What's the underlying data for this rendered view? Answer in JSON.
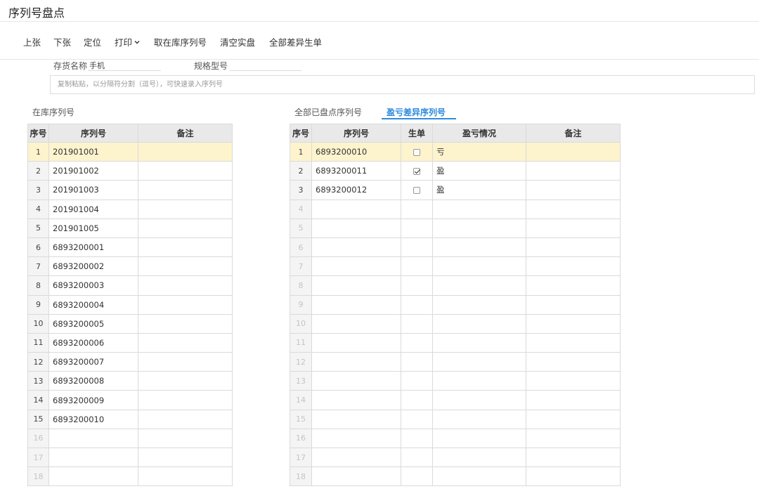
{
  "window": {
    "title": "序列号盘点"
  },
  "toolbar": {
    "prev": "上张",
    "next": "下张",
    "locate": "定位",
    "print": "打印",
    "fetch": "取在库序列号",
    "clear": "清空实盘",
    "all_diff": "全部差异生单"
  },
  "filter": {
    "stock_label": "存货名称",
    "stock_value": "手机",
    "spec_label": "规格型号",
    "spec_value": "",
    "paste_placeholder": "复制粘贴，以分隔符分割（逗号），可快速录入序列号"
  },
  "left": {
    "title": "在库序列号",
    "columns": [
      "序号",
      "序列号",
      "备注"
    ],
    "rows": [
      {
        "no": "1",
        "serial": "201901001",
        "note": ""
      },
      {
        "no": "2",
        "serial": "201901002",
        "note": ""
      },
      {
        "no": "3",
        "serial": "201901003",
        "note": ""
      },
      {
        "no": "4",
        "serial": "201901004",
        "note": ""
      },
      {
        "no": "5",
        "serial": "201901005",
        "note": ""
      },
      {
        "no": "6",
        "serial": "6893200001",
        "note": ""
      },
      {
        "no": "7",
        "serial": "6893200002",
        "note": ""
      },
      {
        "no": "8",
        "serial": "6893200003",
        "note": ""
      },
      {
        "no": "9",
        "serial": "6893200004",
        "note": ""
      },
      {
        "no": "10",
        "serial": "6893200005",
        "note": ""
      },
      {
        "no": "11",
        "serial": "6893200006",
        "note": ""
      },
      {
        "no": "12",
        "serial": "6893200007",
        "note": ""
      },
      {
        "no": "13",
        "serial": "6893200008",
        "note": ""
      },
      {
        "no": "14",
        "serial": "6893200009",
        "note": ""
      },
      {
        "no": "15",
        "serial": "6893200010",
        "note": ""
      },
      {
        "no": "16",
        "serial": "",
        "note": ""
      },
      {
        "no": "17",
        "serial": "",
        "note": ""
      },
      {
        "no": "18",
        "serial": "",
        "note": ""
      }
    ]
  },
  "tabs": [
    {
      "label": "全部已盘点序列号",
      "active": false
    },
    {
      "label": "盈亏差异序列号",
      "active": true
    }
  ],
  "right": {
    "columns": [
      "序号",
      "序列号",
      "生单",
      "盈亏情况",
      "备注"
    ],
    "rows": [
      {
        "no": "1",
        "serial": "6893200010",
        "checked": false,
        "status": "亏",
        "note": ""
      },
      {
        "no": "2",
        "serial": "6893200011",
        "checked": true,
        "status": "盈",
        "note": ""
      },
      {
        "no": "3",
        "serial": "6893200012",
        "checked": false,
        "status": "盈",
        "note": ""
      },
      {
        "no": "4",
        "serial": "",
        "checked": null,
        "status": "",
        "note": ""
      },
      {
        "no": "5",
        "serial": "",
        "checked": null,
        "status": "",
        "note": ""
      },
      {
        "no": "6",
        "serial": "",
        "checked": null,
        "status": "",
        "note": ""
      },
      {
        "no": "7",
        "serial": "",
        "checked": null,
        "status": "",
        "note": ""
      },
      {
        "no": "8",
        "serial": "",
        "checked": null,
        "status": "",
        "note": ""
      },
      {
        "no": "9",
        "serial": "",
        "checked": null,
        "status": "",
        "note": ""
      },
      {
        "no": "10",
        "serial": "",
        "checked": null,
        "status": "",
        "note": ""
      },
      {
        "no": "11",
        "serial": "",
        "checked": null,
        "status": "",
        "note": ""
      },
      {
        "no": "12",
        "serial": "",
        "checked": null,
        "status": "",
        "note": ""
      },
      {
        "no": "13",
        "serial": "",
        "checked": null,
        "status": "",
        "note": ""
      },
      {
        "no": "14",
        "serial": "",
        "checked": null,
        "status": "",
        "note": ""
      },
      {
        "no": "15",
        "serial": "",
        "checked": null,
        "status": "",
        "note": ""
      },
      {
        "no": "16",
        "serial": "",
        "checked": null,
        "status": "",
        "note": ""
      },
      {
        "no": "17",
        "serial": "",
        "checked": null,
        "status": "",
        "note": ""
      },
      {
        "no": "18",
        "serial": "",
        "checked": null,
        "status": "",
        "note": ""
      }
    ]
  },
  "colors": {
    "accent": "#2e8bde",
    "selected_row": "#fdf3cd",
    "header_bg": "#e9e9e9",
    "border": "#dadada"
  }
}
